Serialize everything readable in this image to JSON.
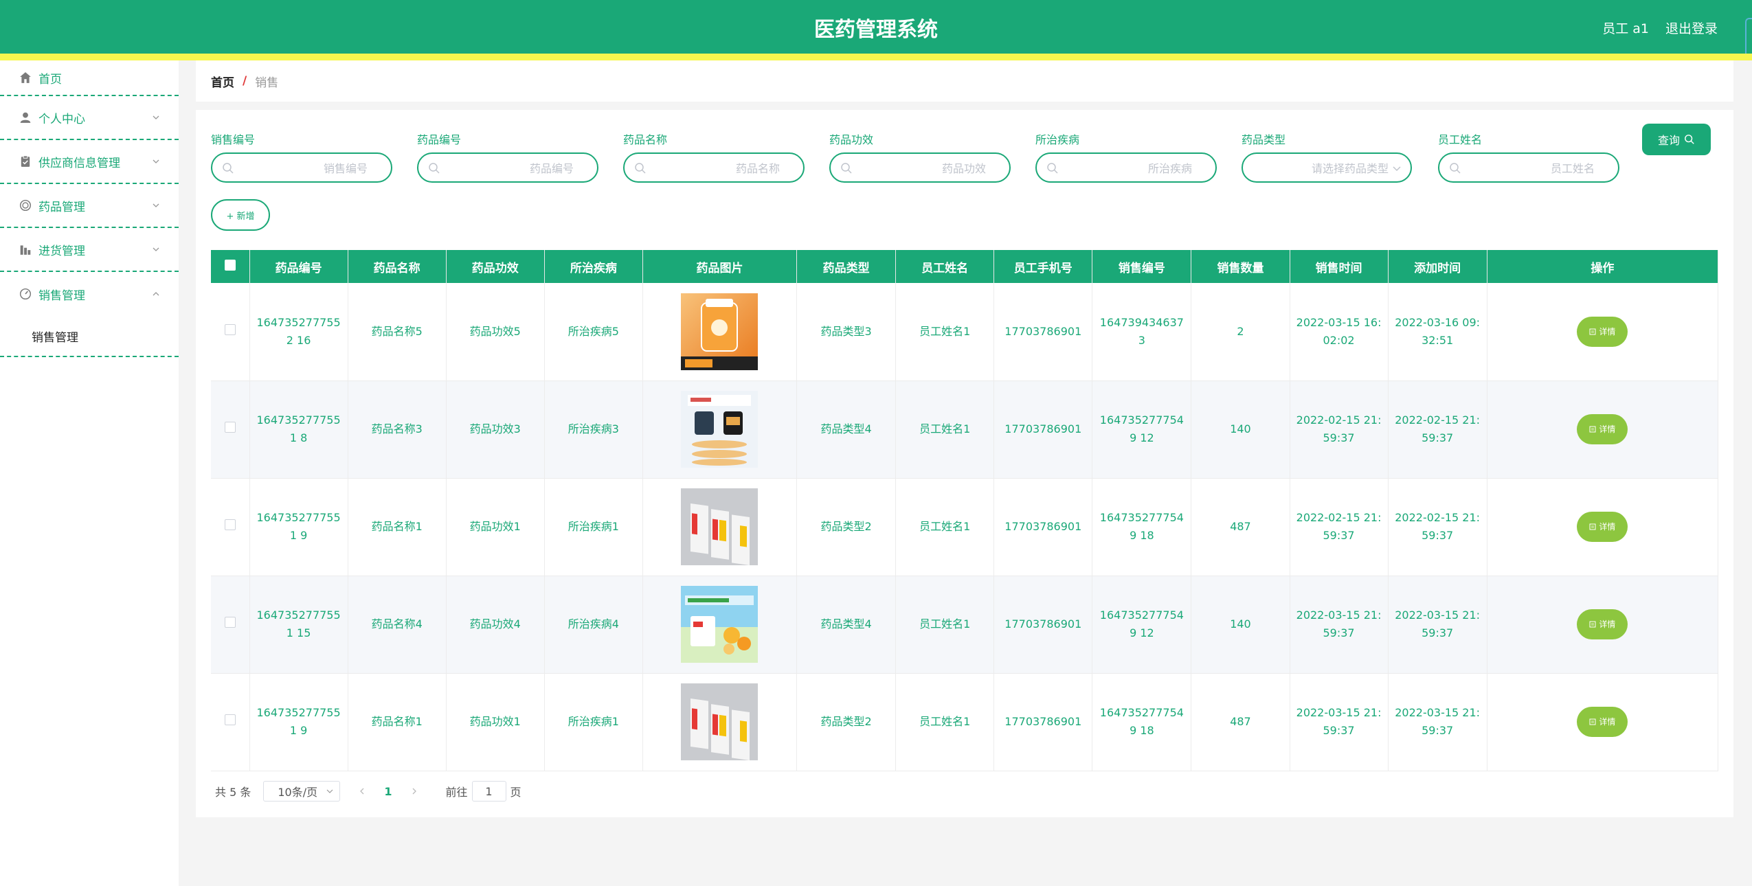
{
  "header": {
    "title": "医药管理系统",
    "user": "员工 a1",
    "logout": "退出登录"
  },
  "sidebar": {
    "items": [
      {
        "label": "首页",
        "icon": "home-icon"
      },
      {
        "label": "个人中心",
        "icon": "user-icon"
      },
      {
        "label": "供应商信息管理",
        "icon": "clipboard-icon"
      },
      {
        "label": "药品管理",
        "icon": "circle-dots-icon"
      },
      {
        "label": "进货管理",
        "icon": "bar-chart-icon"
      },
      {
        "label": "销售管理",
        "icon": "gauge-icon"
      }
    ],
    "submenu": "销售管理"
  },
  "breadcrumb": {
    "home": "首页",
    "separator": "/",
    "current": "销售"
  },
  "filters": [
    {
      "label": "销售编号",
      "placeholder": "销售编号"
    },
    {
      "label": "药品编号",
      "placeholder": "药品编号"
    },
    {
      "label": "药品名称",
      "placeholder": "药品名称"
    },
    {
      "label": "药品功效",
      "placeholder": "药品功效"
    },
    {
      "label": "所治疾病",
      "placeholder": "所治疾病"
    },
    {
      "label": "药品类型",
      "placeholder": "请选择药品类型"
    },
    {
      "label": "员工姓名",
      "placeholder": "员工姓名"
    }
  ],
  "buttons": {
    "query": "查询",
    "add": "+ 新增",
    "detail": "详情"
  },
  "table": {
    "columns": [
      "药品编号",
      "药品名称",
      "药品功效",
      "所治疾病",
      "药品图片",
      "药品类型",
      "员工姓名",
      "员工手机号",
      "销售编号",
      "销售数量",
      "销售时间",
      "添加时间",
      "操作"
    ],
    "rows": [
      {
        "drug_no": "1647352777552 16",
        "name": "药品名称5",
        "effect": "药品功效5",
        "disease": "所治疾病5",
        "image": "orange-bottle",
        "type": "药品类型3",
        "staff": "员工姓名1",
        "phone": "17703786901",
        "sale_no": "1647394346373",
        "qty": "2",
        "sale_time": "2022-03-15 16: 02:02",
        "add_time": "2022-03-16 09: 32:51"
      },
      {
        "drug_no": "1647352777551 8",
        "name": "药品名称3",
        "effect": "药品功效3",
        "disease": "所治疾病3",
        "image": "two-bottles",
        "type": "药品类型4",
        "staff": "员工姓名1",
        "phone": "17703786901",
        "sale_no": "1647352777549 12",
        "qty": "140",
        "sale_time": "2022-02-15 21: 59:37",
        "add_time": "2022-02-15 21: 59:37"
      },
      {
        "drug_no": "1647352777551 9",
        "name": "药品名称1",
        "effect": "药品功效1",
        "disease": "所治疾病1",
        "image": "three-boxes",
        "type": "药品类型2",
        "staff": "员工姓名1",
        "phone": "17703786901",
        "sale_no": "1647352777549 18",
        "qty": "487",
        "sale_time": "2022-02-15 21: 59:37",
        "add_time": "2022-02-15 21: 59:37"
      },
      {
        "drug_no": "1647352777551 15",
        "name": "药品名称4",
        "effect": "药品功效4",
        "disease": "所治疾病4",
        "image": "vitamin-c",
        "type": "药品类型4",
        "staff": "员工姓名1",
        "phone": "17703786901",
        "sale_no": "1647352777549 12",
        "qty": "140",
        "sale_time": "2022-03-15 21: 59:37",
        "add_time": "2022-03-15 21: 59:37"
      },
      {
        "drug_no": "1647352777551 9",
        "name": "药品名称1",
        "effect": "药品功效1",
        "disease": "所治疾病1",
        "image": "three-boxes",
        "type": "药品类型2",
        "staff": "员工姓名1",
        "phone": "17703786901",
        "sale_no": "1647352777549 18",
        "qty": "487",
        "sale_time": "2022-03-15 21: 59:37",
        "add_time": "2022-03-15 21: 59:37"
      }
    ]
  },
  "pagination": {
    "total": "共 5 条",
    "page_size": "10条/页",
    "current_page": "1",
    "goto_prefix": "前往",
    "goto_value": "1",
    "goto_suffix": "页"
  },
  "colors": {
    "primary": "#1aa877",
    "accent_stripe": "#f6f64e",
    "detail_button": "#8dc63f"
  }
}
